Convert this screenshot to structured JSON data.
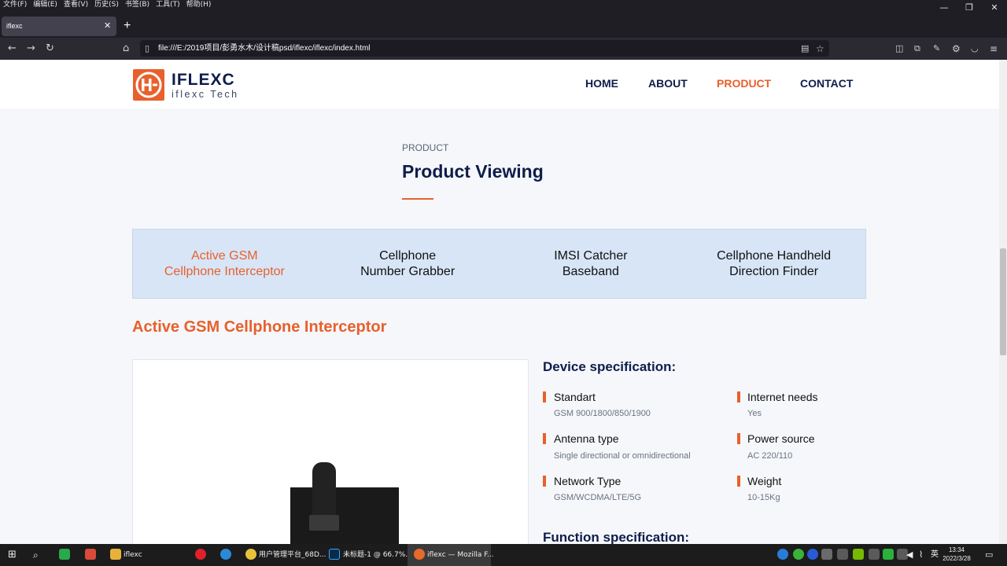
{
  "browser": {
    "menu": [
      "文件(F)",
      "编辑(E)",
      "查看(V)",
      "历史(S)",
      "书签(B)",
      "工具(T)",
      "帮助(H)"
    ],
    "tab_title": "iflexc",
    "url": "file:///E:/2019项目/彭勇水木/设计稿psd/iflexc/iflexc/index.html"
  },
  "site": {
    "logo_name": "IFLEXC",
    "logo_sub": "iflexc Tech",
    "nav": [
      "HOME",
      "ABOUT",
      "PRODUCT",
      "CONTACT"
    ],
    "active_nav": "PRODUCT"
  },
  "section": {
    "label": "PRODUCT",
    "title": "Product Viewing"
  },
  "categories": [
    {
      "label": "Active GSM\nCellphone Interceptor",
      "active": true
    },
    {
      "label": "Cellphone\nNumber Grabber",
      "active": false
    },
    {
      "label": "IMSI Catcher\nBaseband",
      "active": false
    },
    {
      "label": "Cellphone Handheld\nDirection Finder",
      "active": false
    }
  ],
  "product": {
    "title": "Active GSM Cellphone Interceptor",
    "device_spec_title": "Device specification:",
    "specs": [
      {
        "label": "Standart",
        "value": "GSM 900/1800/850/1900"
      },
      {
        "label": "Internet needs",
        "value": "Yes"
      },
      {
        "label": "Antenna type",
        "value": "Single directional or omnidirectional"
      },
      {
        "label": "Power source",
        "value": "AC 220/110"
      },
      {
        "label": "Network Type",
        "value": "GSM/WCDMA/LTE/5G"
      },
      {
        "label": "Weight",
        "value": "10-15Kg"
      }
    ],
    "function_spec_title": "Function specification:"
  },
  "taskbar": {
    "items": [
      "iflexc",
      "用户管理平台_68D...",
      "未标题-1 @ 66.7%...",
      "iflexc — Mozilla F..."
    ],
    "time": "13:34",
    "date": "2022/3/28",
    "ime": "英"
  },
  "colors": {
    "accent": "#e8602c",
    "navy": "#0f1d4a",
    "tab_bg": "#d7e5f7"
  }
}
